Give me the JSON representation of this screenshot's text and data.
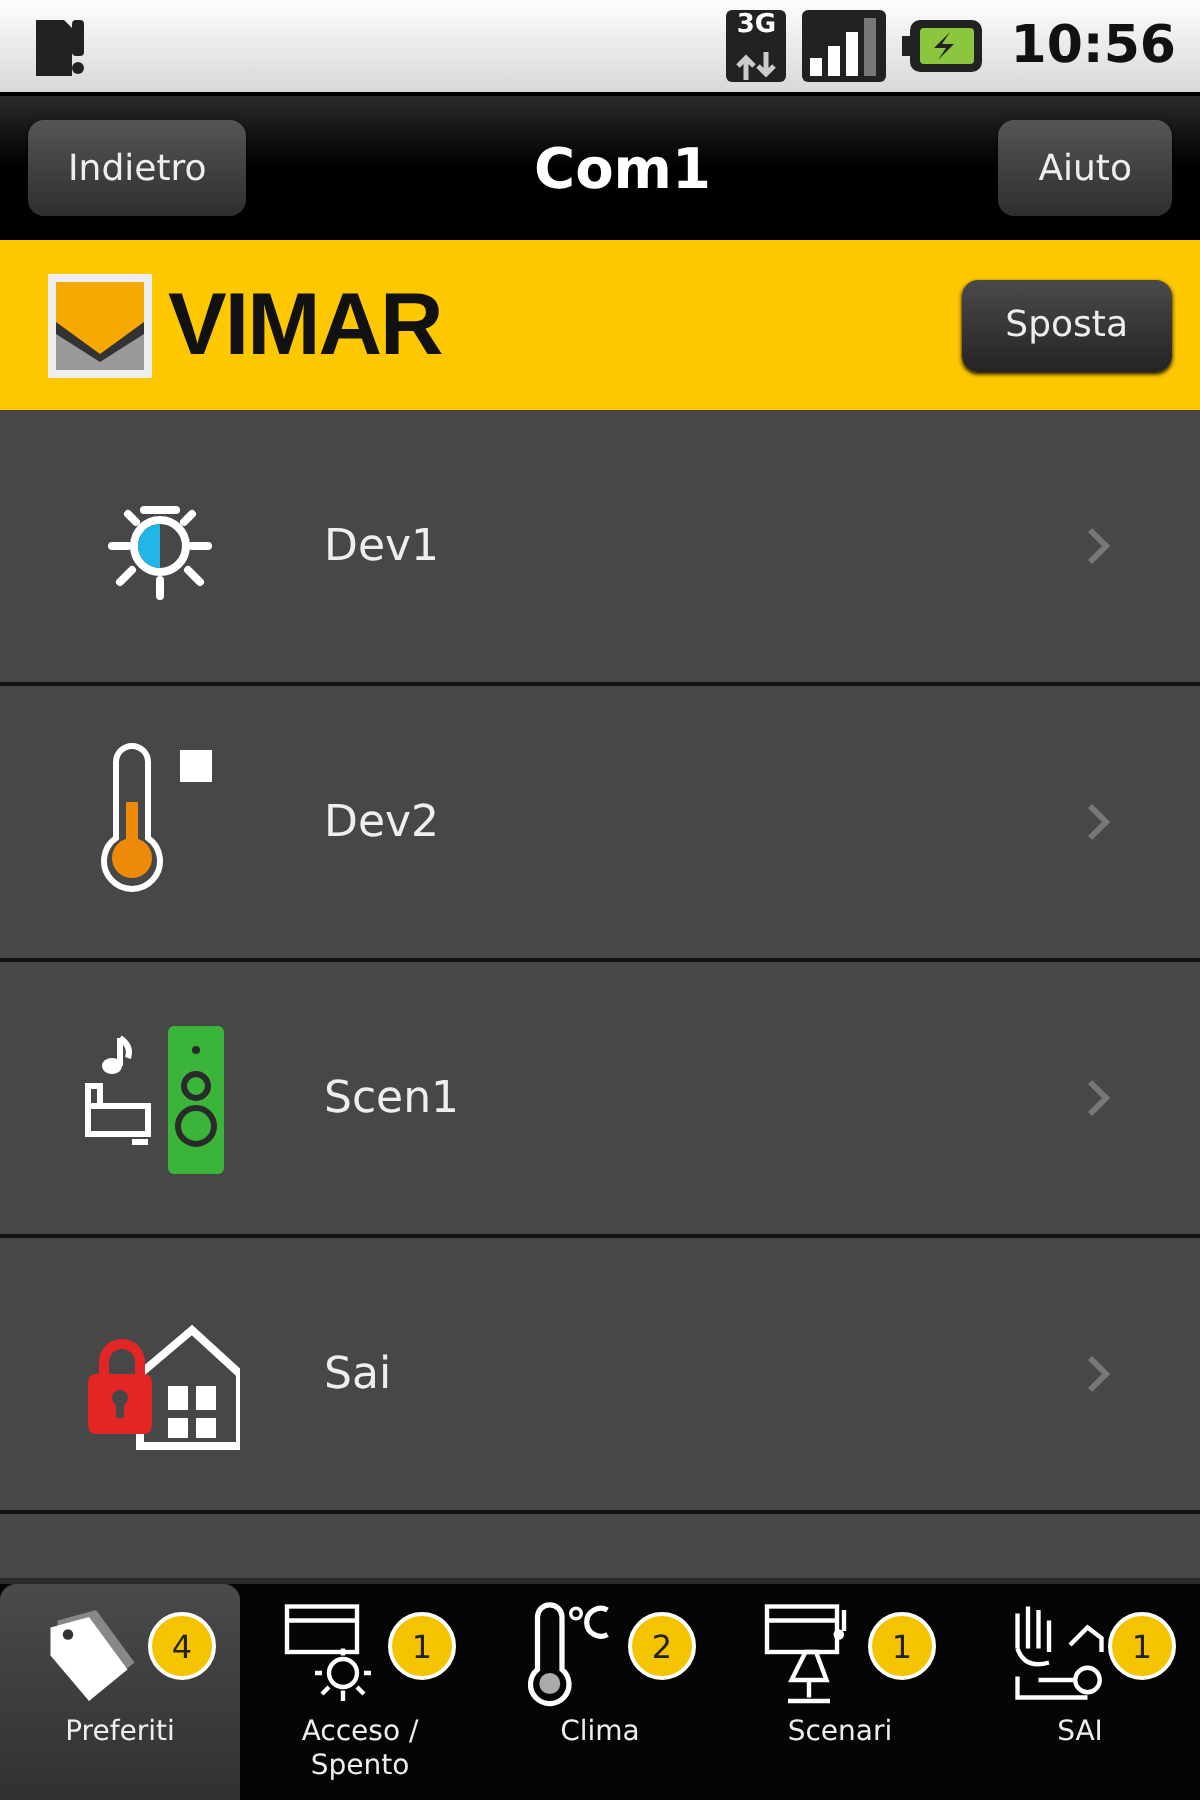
{
  "status_bar": {
    "network": "3G",
    "time": "10:56"
  },
  "title_bar": {
    "back": "Indietro",
    "title": "Com1",
    "help": "Aiuto"
  },
  "brand_bar": {
    "logo": "VIMAR",
    "move": "Sposta"
  },
  "devices": [
    {
      "kind": "light",
      "name": "Dev1"
    },
    {
      "kind": "thermostat",
      "name": "Dev2"
    },
    {
      "kind": "scenario",
      "name": "Scen1"
    },
    {
      "kind": "alarm",
      "name": "Sai"
    }
  ],
  "tabs": [
    {
      "kind": "favorites",
      "label": "Preferiti",
      "badge": "4",
      "selected": true
    },
    {
      "kind": "onoff",
      "label": "Acceso / Spento",
      "badge": "1",
      "selected": false
    },
    {
      "kind": "climate",
      "label": "Clima",
      "badge": "2",
      "selected": false
    },
    {
      "kind": "scenes",
      "label": "Scenari",
      "badge": "1",
      "selected": false
    },
    {
      "kind": "security",
      "label": "SAI",
      "badge": "1",
      "selected": false
    }
  ]
}
